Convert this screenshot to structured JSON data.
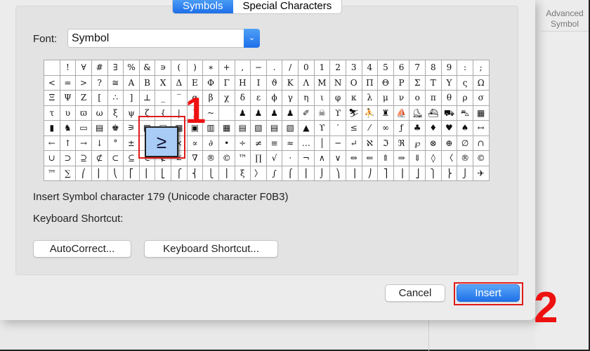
{
  "side_panel": {
    "tab_label": "Advanced Symbol"
  },
  "tabs": [
    {
      "label": "Symbols",
      "selected": true
    },
    {
      "label": "Special Characters",
      "selected": false
    }
  ],
  "font": {
    "label": "Font:",
    "value": "Symbol"
  },
  "grid": {
    "rows": [
      [
        " ",
        "!",
        "∀",
        "#",
        "∃",
        "%",
        "&",
        "∍",
        "(",
        ")",
        "∗",
        "+",
        ",",
        "−",
        ".",
        "/",
        "0",
        "1",
        "2",
        "3",
        "4",
        "5",
        "6",
        "7",
        "8",
        "9",
        ":",
        ";"
      ],
      [
        "<",
        "=",
        ">",
        "?",
        "≅",
        "Α",
        "Β",
        "Χ",
        "Δ",
        "Ε",
        "Φ",
        "Γ",
        "Η",
        "Ι",
        "ϑ",
        "Κ",
        "Λ",
        "Μ",
        "Ν",
        "Ο",
        "Π",
        "Θ",
        "Ρ",
        "Σ",
        "Τ",
        "Υ",
        "ς",
        "Ω"
      ],
      [
        "Ξ",
        "Ψ",
        "Ζ",
        "[",
        "∴",
        "]",
        "⊥",
        "_",
        "‾",
        "α",
        "β",
        "χ",
        "δ",
        "ε",
        "ϕ",
        "γ",
        "η",
        "ι",
        "φ",
        "κ",
        "λ",
        "μ",
        "ν",
        "ο",
        "π",
        "θ",
        "ρ",
        "σ"
      ],
      [
        "τ",
        "υ",
        "ϖ",
        "ω",
        "ξ",
        "ψ",
        "ζ",
        "{",
        "|",
        "}",
        "~",
        "",
        "♟",
        "♟",
        "♟",
        "♟",
        "✐",
        "☠",
        "ϒ",
        "⛷",
        "⛹",
        "♜",
        "⛵",
        "⛸",
        "⛴",
        "⛟",
        "⛍",
        "▦"
      ],
      [
        "▮",
        "♞",
        "▭",
        "▤",
        "♚",
        "⚞",
        "▦",
        "▤",
        "▩",
        "▣",
        "▥",
        "▦",
        "▤",
        "▧",
        "▤",
        "▧",
        "▲",
        "ϒ",
        "′",
        "≤",
        "⁄",
        "∞",
        "ƒ",
        "♣",
        "♦",
        "♥",
        "♠",
        "↔"
      ],
      [
        "←",
        "↑",
        "→",
        "↓",
        "°",
        "±",
        "″",
        "≥",
        "×",
        "∝",
        "∂",
        "•",
        "÷",
        "≠",
        "≡",
        "≈",
        "…",
        "│",
        "─",
        "↵",
        "ℵ",
        "ℑ",
        "ℜ",
        "℘",
        "⊗",
        "⊕",
        "∅",
        "∩"
      ],
      [
        "∪",
        "⊃",
        "⊇",
        "⊄",
        "⊂",
        "⊆",
        "∈",
        "∉",
        "∠",
        "∇",
        "®",
        "©",
        "™",
        "∏",
        "√",
        "⋅",
        "¬",
        "∧",
        "∨",
        "⇔",
        "⇐",
        "⇑",
        "⇒",
        "⇓",
        "◊",
        "〈",
        "®",
        "©"
      ],
      [
        "™",
        "∑",
        "⎛",
        "⎜",
        "⎝",
        "⎡",
        "⎢",
        "⎣",
        "⎧",
        "⎨",
        "⎩",
        "⎪",
        "ξ",
        "〉",
        "∫",
        "⌠",
        "⎮",
        "⌡",
        "⎞",
        "⎟",
        "⎠",
        "⎤",
        "⎥",
        "⎦",
        "⎫",
        "⎬",
        "⎭",
        "✈"
      ]
    ],
    "selected": "≥"
  },
  "info_line": "Insert Symbol character 179  (Unicode character F0B3)",
  "shortcut_label": "Keyboard Shortcut:",
  "buttons": {
    "autocorrect": "AutoCorrect...",
    "keyboard_shortcut": "Keyboard Shortcut...",
    "cancel": "Cancel",
    "insert": "Insert"
  },
  "annotations": {
    "step1": "1",
    "step2": "2"
  },
  "colors": {
    "accent": "#1d6fe8",
    "annotation": "#e01b1b",
    "selected_cell": "#a8ccf6"
  }
}
